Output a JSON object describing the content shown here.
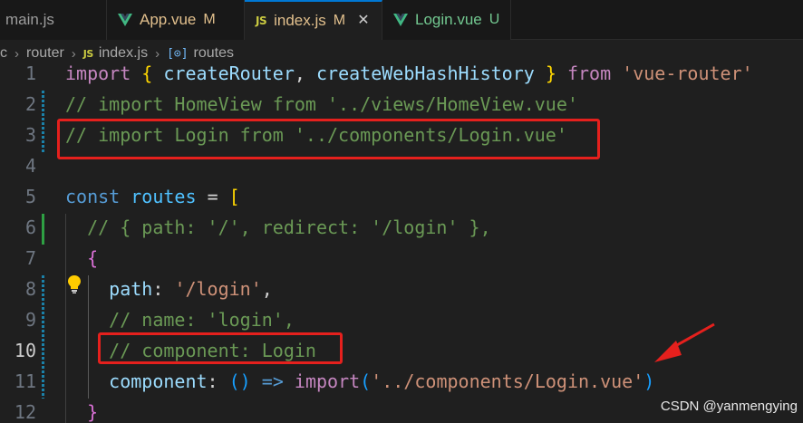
{
  "tabs": [
    {
      "name": "main.js",
      "icon": "js-icon",
      "badge": "",
      "status": ""
    },
    {
      "name": "App.vue",
      "icon": "vue-icon",
      "badge": "M",
      "status": "modified"
    },
    {
      "name": "index.js",
      "icon": "js-icon-label",
      "icon_text": "JS",
      "badge": "M",
      "status": "active"
    },
    {
      "name": "Login.vue",
      "icon": "vue-icon",
      "badge": "U",
      "status": "untracked"
    }
  ],
  "close_glyph": "✕",
  "breadcrumb": {
    "items": [
      "c",
      "router",
      "index.js",
      "routes"
    ],
    "js_icon_text": "JS",
    "symbol_icon_text": "[⊙]",
    "separator": "›"
  },
  "lines": [
    {
      "num": "1",
      "tokens": [
        [
          "import",
          "k-kw"
        ],
        [
          " ",
          ""
        ],
        [
          "{",
          "k-br1"
        ],
        [
          " ",
          ""
        ],
        [
          "createRouter",
          "k-var"
        ],
        [
          ", ",
          "k-pun"
        ],
        [
          "createWebHashHistory",
          "k-var"
        ],
        [
          " ",
          ""
        ],
        [
          "}",
          "k-br1"
        ],
        [
          " ",
          ""
        ],
        [
          "from",
          "k-kw"
        ],
        [
          " ",
          ""
        ],
        [
          "'vue-router'",
          "k-str"
        ]
      ]
    },
    {
      "num": "2",
      "tokens": [
        [
          "// import HomeView from '../views/HomeView.vue'",
          "k-cmt"
        ]
      ]
    },
    {
      "num": "3",
      "tokens": [
        [
          "// import Login from '../components/Login.vue'",
          "k-cmt"
        ]
      ]
    },
    {
      "num": "4",
      "tokens": []
    },
    {
      "num": "5",
      "tokens": [
        [
          "const",
          "k-decl"
        ],
        [
          " ",
          ""
        ],
        [
          "routes",
          "k-const"
        ],
        [
          " ",
          ""
        ],
        [
          "=",
          "k-op"
        ],
        [
          " ",
          ""
        ],
        [
          "[",
          "k-br1"
        ]
      ]
    },
    {
      "num": "6",
      "tokens": [
        [
          "  ",
          ""
        ],
        [
          "// { path: '/', redirect: '/login' },",
          "k-cmt"
        ]
      ]
    },
    {
      "num": "7",
      "tokens": [
        [
          "  ",
          ""
        ],
        [
          "{",
          "k-br2"
        ]
      ]
    },
    {
      "num": "8",
      "tokens": [
        [
          "    ",
          ""
        ],
        [
          "path",
          "k-var"
        ],
        [
          ": ",
          "k-pun"
        ],
        [
          "'/login'",
          "k-str"
        ],
        [
          ",",
          "k-pun"
        ]
      ]
    },
    {
      "num": "9",
      "tokens": [
        [
          "    ",
          ""
        ],
        [
          "// name: 'login',",
          "k-cmt"
        ]
      ]
    },
    {
      "num": "10",
      "tokens": [
        [
          "    ",
          ""
        ],
        [
          "// component: Login",
          "k-cmt"
        ]
      ]
    },
    {
      "num": "11",
      "tokens": [
        [
          "    ",
          ""
        ],
        [
          "component",
          "k-var"
        ],
        [
          ": ",
          "k-pun"
        ],
        [
          "()",
          "k-br3"
        ],
        [
          " ",
          ""
        ],
        [
          "=>",
          "k-arrow"
        ],
        [
          " ",
          ""
        ],
        [
          "import",
          "k-kw"
        ],
        [
          "(",
          "k-br3"
        ],
        [
          "'../components/Login.vue'",
          "k-str"
        ],
        [
          ")",
          "k-br3"
        ]
      ]
    },
    {
      "num": "12",
      "tokens": [
        [
          "  ",
          ""
        ],
        [
          "}",
          "k-br2"
        ]
      ]
    }
  ],
  "active_line": "10",
  "colors": {
    "highlight_box": "#e5201d",
    "accent": "#0078d4"
  },
  "watermark": "CSDN @yanmengying"
}
